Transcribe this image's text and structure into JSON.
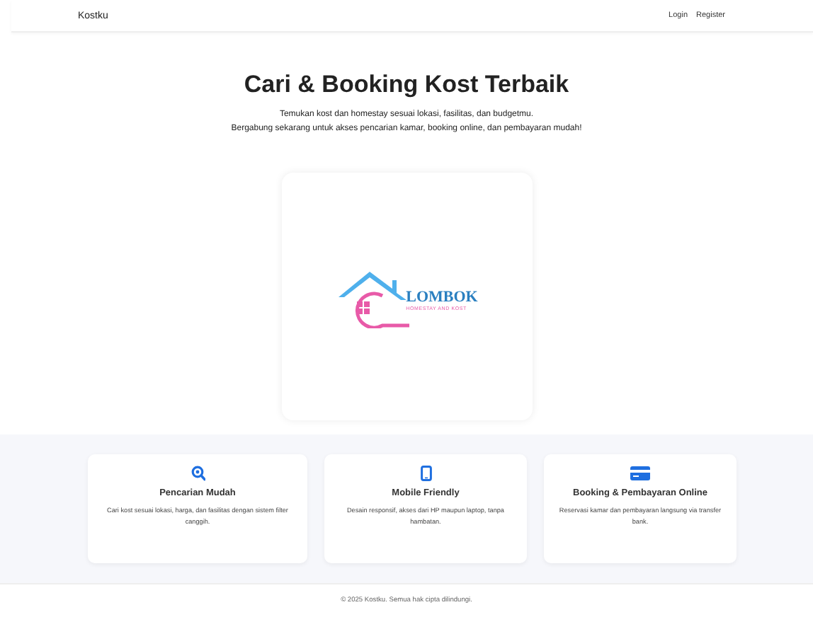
{
  "navbar": {
    "brand": "Kostku",
    "links": [
      "Login",
      "Register"
    ]
  },
  "hero": {
    "title": "Cari & Booking Kost Terbaik",
    "lines": [
      "Temukan kost dan homestay sesuai lokasi, fasilitas, dan budgetmu.",
      "Bergabung sekarang untuk akses pencarian kamar, booking online, dan pembayaran mudah!"
    ]
  },
  "logo": {
    "name": "LOMBOK",
    "tagline": "HOMESTAY AND KOST"
  },
  "features": [
    {
      "kind": "search",
      "title": "Pencarian Mudah",
      "text": "Cari kost sesuai lokasi, harga, dan fasilitas dengan sistem filter canggih."
    },
    {
      "kind": "mobile",
      "title": "Mobile Friendly",
      "text": "Desain responsif, akses dari HP maupun laptop, tanpa hambatan."
    },
    {
      "kind": "card",
      "title": "Booking & Pembayaran Online",
      "text": "Reservasi kamar dan pembayaran langsung via transfer bank."
    }
  ],
  "footer": "© 2025 Kostku. Semua hak cipta dilindungi."
}
